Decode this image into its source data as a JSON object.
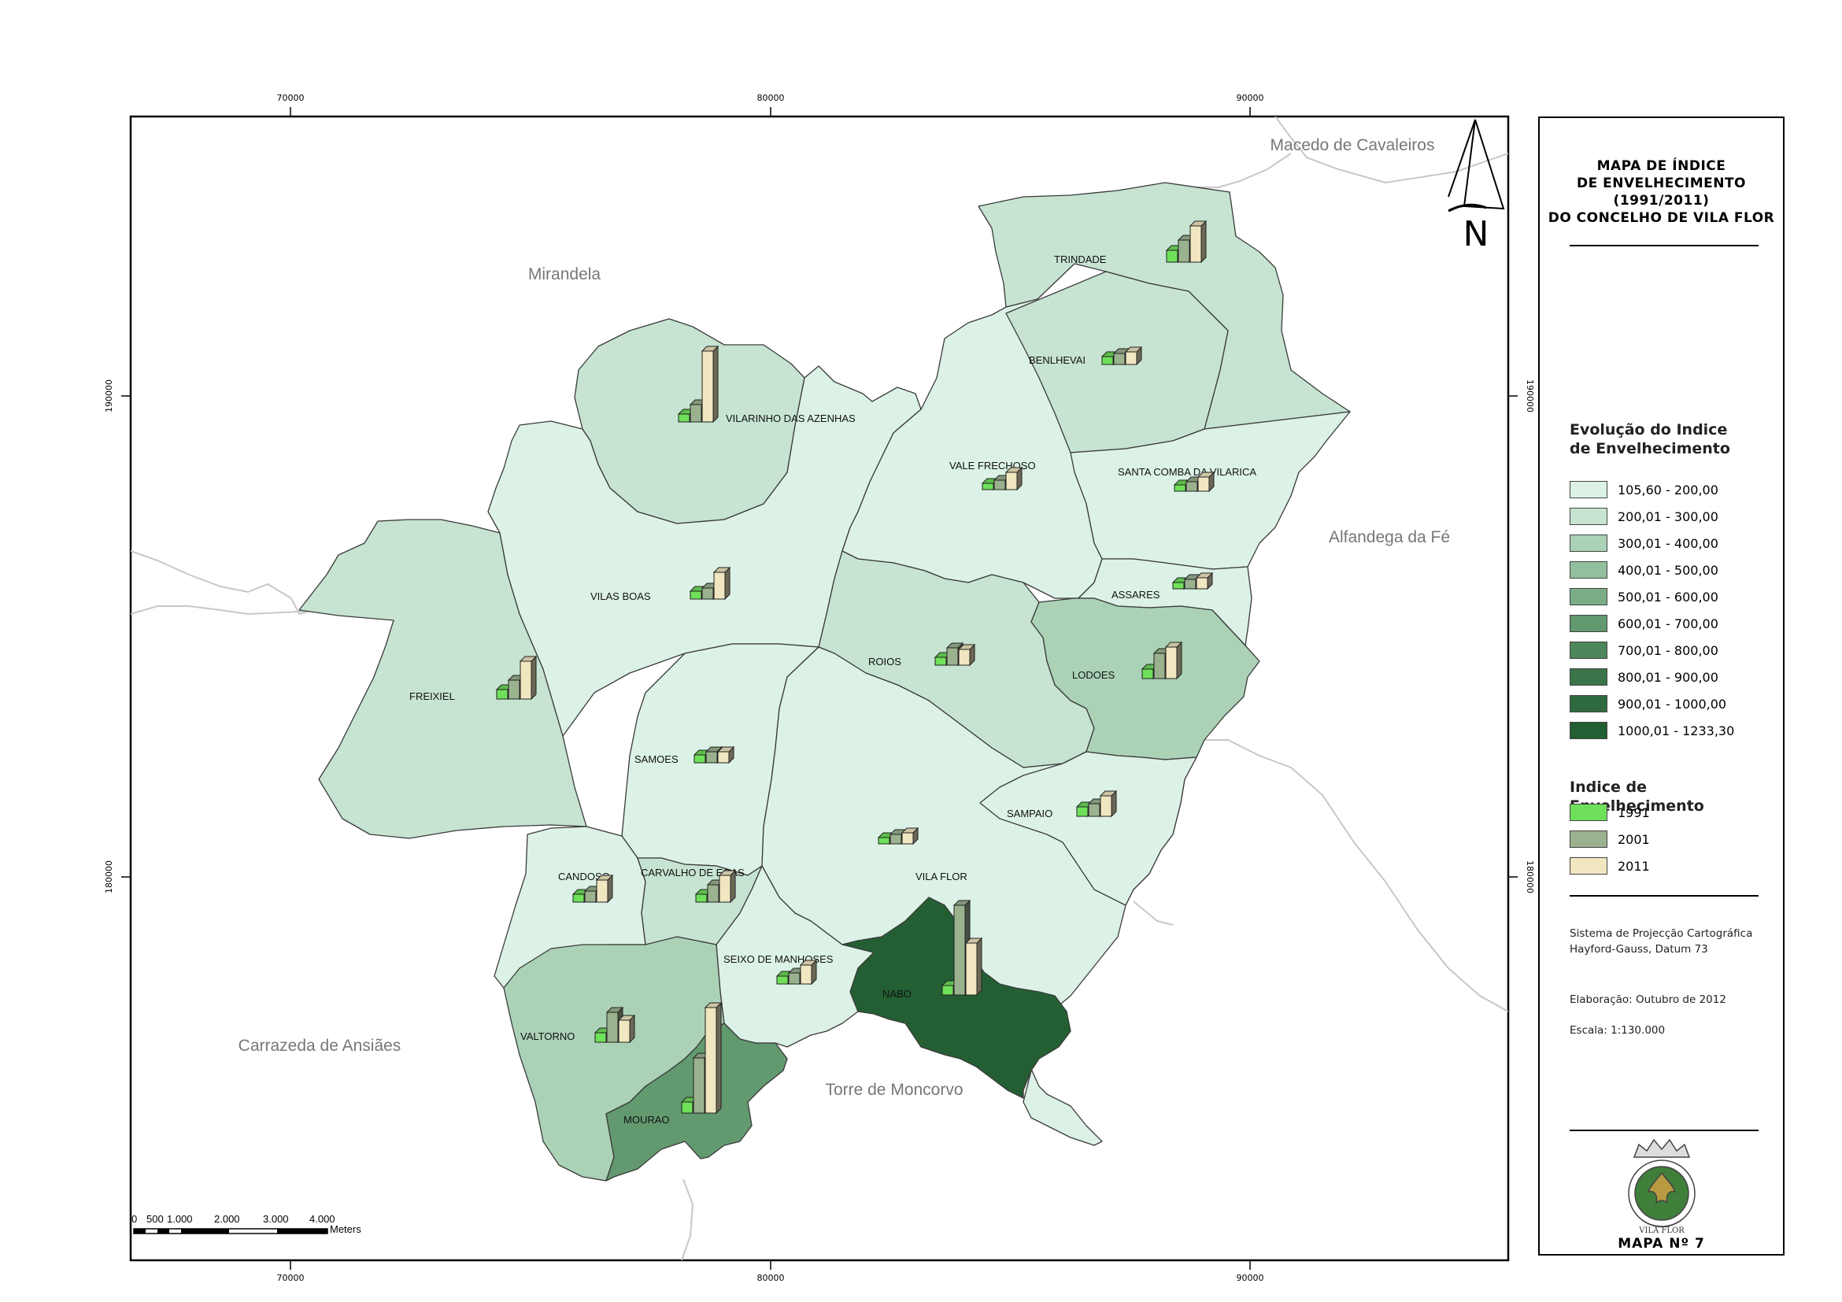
{
  "map": {
    "neighbors": {
      "macedo": "Macedo de Cavaleiros",
      "mirandela": "Mirandela",
      "alfandega": "Alfandega da Fé",
      "carrazeda": "Carrazeda de Ansiães",
      "moncorvo": "Torre de Moncorvo"
    },
    "coords": {
      "x1": "70000",
      "x2": "80000",
      "x3": "90000",
      "y1": "190000",
      "y2": "180000"
    },
    "north": "N",
    "parishes": {
      "trindade": "TRINDADE",
      "benlhevai": "BENLHEVAI",
      "vilarinho": "VILARINHO DAS AZENHAS",
      "valefrechoso": "VALE FRECHOSO",
      "santacomba": "SANTA COMBA DA VILARICA",
      "vilasboas": "VILAS BOAS",
      "assares": "ASSARES",
      "freixiel": "FREIXIEL",
      "roios": "ROIOS",
      "lodoes": "LODOES",
      "samoes": "SAMOES",
      "sampaio": "SAMPAIO",
      "candoso": "CANDOSO",
      "carvalho": "CARVALHO DE EGAS",
      "vilaflor": "VILA FLOR",
      "seixo": "SEIXO DE MANHOSES",
      "nabo": "NABO",
      "valtorno": "VALTORNO",
      "mourao": "MOURAO"
    },
    "scalebar": {
      "t0": "0",
      "t1": "500",
      "t2": "1.000",
      "t3": "2.000",
      "t4": "3.000",
      "t5": "4.000",
      "unit": "Meters"
    },
    "colors": {
      "c1": "#dcf2e6",
      "c2": "#c6e4d1",
      "c3": "#abd2b6",
      "c4": "#92c09e",
      "c5": "#7aad86",
      "c6": "#62996f",
      "c7": "#4d865b",
      "c8": "#3a7448",
      "c9": "#2e6a3e",
      "c10": "#235f33",
      "bar1991": "#6fe05a",
      "bar2001": "#9bb28f",
      "bar2011": "#f0e6c0"
    }
  },
  "legend": {
    "title": [
      "MAPA DE ÍNDICE",
      "DE ENVELHECIMENTO",
      "(1991/2011)",
      "DO CONCELHO DE VILA FLOR"
    ],
    "classes_title": [
      "Evolução do Indice",
      "de Envelhecimento"
    ],
    "classes": [
      {
        "label": "105,60 - 200,00",
        "color": "#dcf2e6"
      },
      {
        "label": "200,01 - 300,00",
        "color": "#c6e4d1"
      },
      {
        "label": "300,01 - 400,00",
        "color": "#abd2b6"
      },
      {
        "label": "400,01 - 500,00",
        "color": "#92c09e"
      },
      {
        "label": "500,01 - 600,00",
        "color": "#7aad86"
      },
      {
        "label": "600,01 - 700,00",
        "color": "#62996f"
      },
      {
        "label": "700,01 - 800,00",
        "color": "#4d865b"
      },
      {
        "label": "800,01 - 900,00",
        "color": "#3a7448"
      },
      {
        "label": "900,01 - 1000,00",
        "color": "#2e6a3e"
      },
      {
        "label": "1000,01 - 1233,30",
        "color": "#235f33"
      }
    ],
    "index_title": "Indice de Envelhecimento",
    "years": [
      {
        "label": "1991",
        "color": "#6fe05a"
      },
      {
        "label": "2001",
        "color": "#9bb28f"
      },
      {
        "label": "2011",
        "color": "#f0e6c0"
      }
    ],
    "projection": [
      "Sistema de Projecção Cartográfica",
      "Hayford-Gauss, Datum 73"
    ],
    "elaboration": "Elaboração: Outubro de 2012",
    "scale": "Escala: 1:130.000",
    "crest_text": "VILA FLOR",
    "map_number": "MAPA Nº 7"
  }
}
